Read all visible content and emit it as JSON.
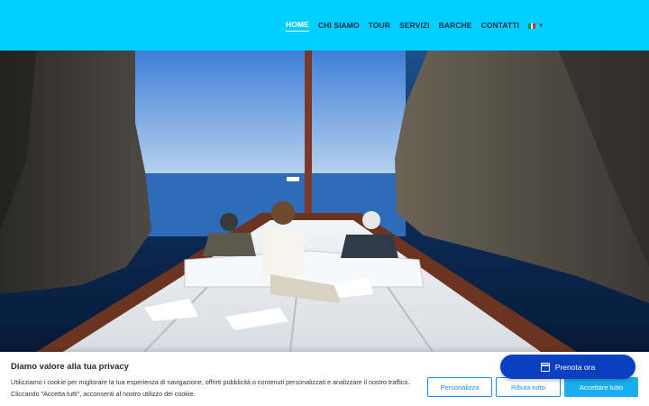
{
  "nav": {
    "items": [
      {
        "label": "HOME",
        "active": true
      },
      {
        "label": "CHI SIAMO",
        "active": false
      },
      {
        "label": "TOUR",
        "active": false
      },
      {
        "label": "SERVIZI",
        "active": false
      },
      {
        "label": "BARCHE",
        "active": false
      },
      {
        "label": "CONTATTI",
        "active": false
      }
    ],
    "language_icon": "italian-flag-icon",
    "flag_colors": [
      "#009246",
      "#ffffff",
      "#ce2b37"
    ]
  },
  "colors": {
    "header_bg": "#00cfff",
    "book_button": "#0a3fbf",
    "accept_button": "#1aaef0",
    "outline_button": "#1a8cff"
  },
  "hero": {
    "image": "boat-in-sea-cave-photo"
  },
  "cookie": {
    "title": "Diamo valore alla tua privacy",
    "text": "Utilizziamo i cookie per migliorare la tua esperienza di navigazione, offrirti pubblicità o contenuti personalizzati e analizzare il nostro traffico. Cliccando \"Accetta tutti\", acconsenti al nostro utilizzo dei cookie.",
    "customize_label": "Personalizza",
    "reject_label": "Rifiuta tutto",
    "accept_label": "Accettare tutto"
  },
  "book": {
    "label": "Prenota ora",
    "icon": "calendar-icon"
  }
}
